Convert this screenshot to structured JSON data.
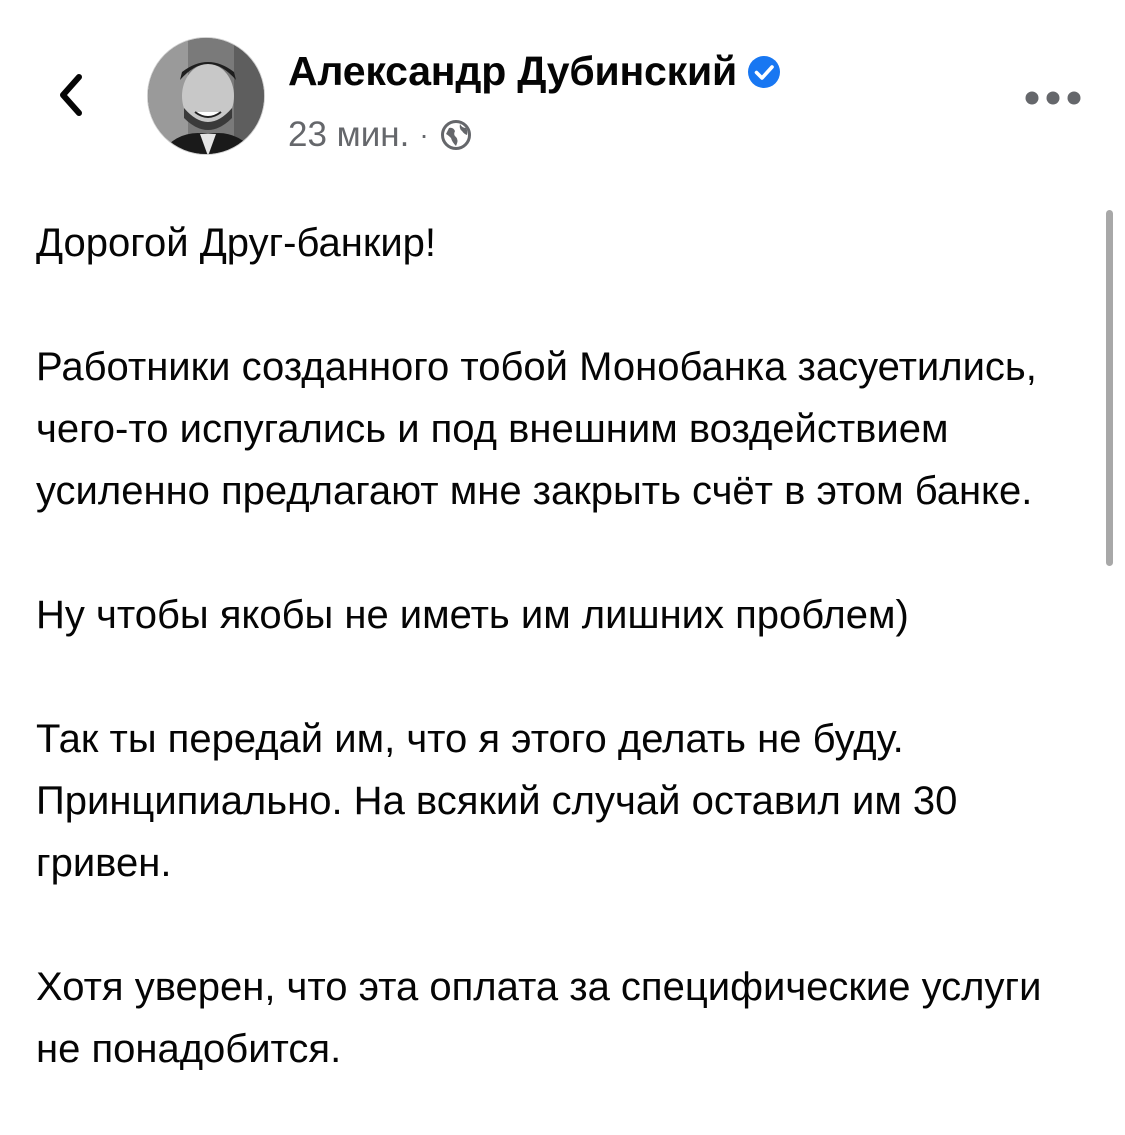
{
  "colors": {
    "text": "#050505",
    "meta": "#65676b",
    "verified_badge": "#1877f2",
    "scrollbar": "#a8a8a8"
  },
  "header": {
    "back_icon": "chevron-left-icon",
    "author_name": "Александр Дубинский",
    "verified_icon": "verified-badge-icon",
    "timestamp": "23 мин.",
    "separator": "·",
    "audience_icon": "globe-icon",
    "more_icon": "more-options-icon"
  },
  "post": {
    "paragraphs": [
      "Дорогой Друг-банкир!",
      "Работники созданного тобой Монобанка засуетились, чего-то испугались и под внешним воздействием усиленно предлагают мне закрыть счёт в этом банке.",
      "Ну чтобы якобы не иметь им лишних проблем)",
      "Так ты передай им, что я этого делать не буду. Принципиально. На всякий случай оставил им 30 гривен.",
      "Хотя уверен, что эта оплата за специфические услуги не понадобится."
    ]
  }
}
